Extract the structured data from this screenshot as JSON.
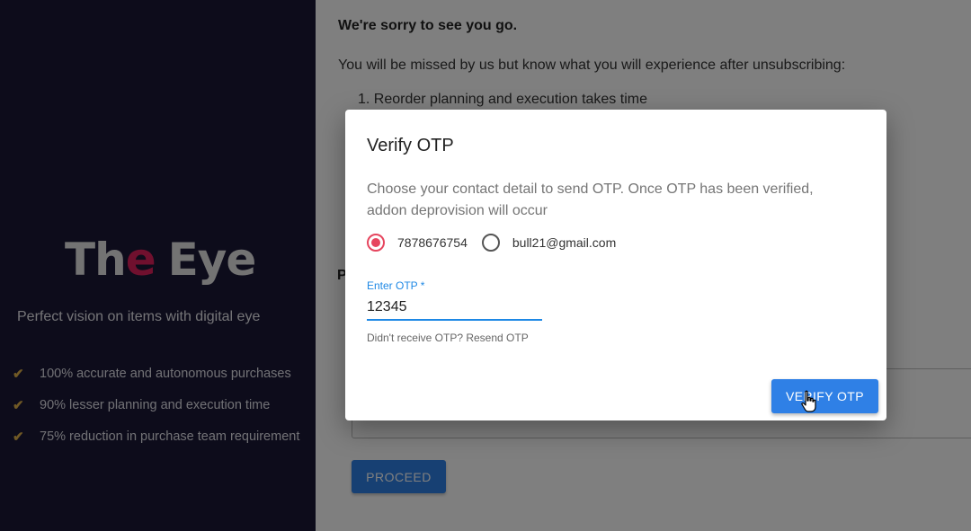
{
  "brand": {
    "logo_the": "Th",
    "logo_e": "e",
    "logo_eye": "Eye",
    "tagline": "Perfect vision on items with digital eye",
    "features": [
      "100% accurate and autonomous purchases",
      "90% lesser planning and execution time",
      "75% reduction in purchase team requirement"
    ],
    "check_icon": "✔"
  },
  "content": {
    "title": "We're sorry to see you go.",
    "missed_text": "You will be missed by us but know what you will experience after unsubscribing:",
    "list_item_1": "1. Reorder planning and execution takes time",
    "partial_label": "P",
    "proceed_label": "PROCEED"
  },
  "dialog": {
    "title": "Verify OTP",
    "description": "Choose your contact detail to send OTP. Once OTP has been verified, addon deprovision will occur",
    "phone_option": "7878676754",
    "email_option": "bull21@gmail.com",
    "otp_label": "Enter OTP *",
    "otp_value": "12345",
    "resend_text": "Didn't receive OTP? Resend OTP",
    "verify_label": "VERIFY OTP"
  },
  "colors": {
    "panel_bg": "#1b1836",
    "logo_accent": "#e0205c",
    "check": "#e0b24a",
    "primary": "#2f80e6",
    "radio_selected": "#e6455e",
    "focus": "#1e88e5"
  },
  "icons": {
    "check": "check-icon",
    "cursor": "hand-pointer-icon"
  }
}
